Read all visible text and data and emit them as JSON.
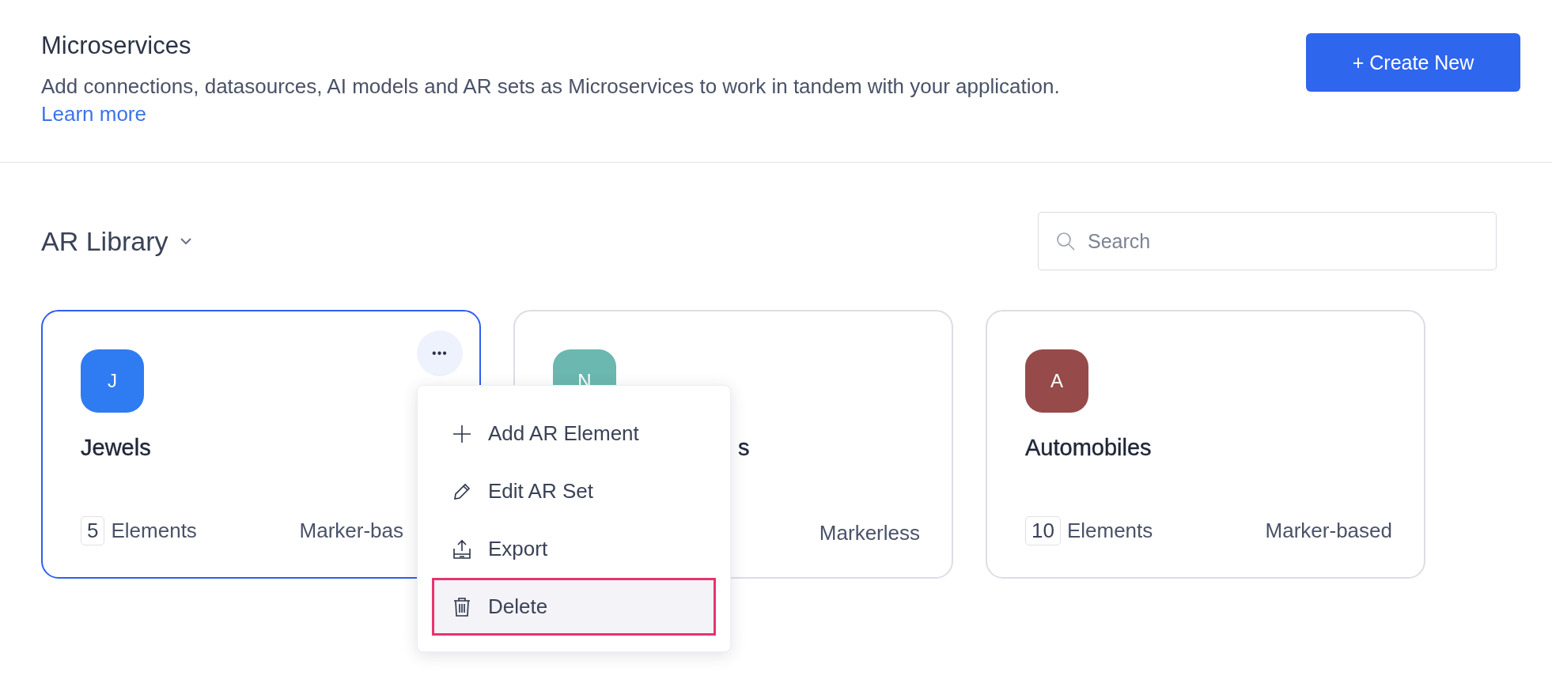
{
  "header": {
    "title": "Microservices",
    "description": "Add connections, datasources, AI models and AR sets as Microservices to work in tandem with your application.",
    "link": "Learn more",
    "create_button": "+ Create New"
  },
  "library": {
    "title": "AR Library",
    "search": {
      "placeholder": "Search"
    }
  },
  "cards": [
    {
      "initial": "J",
      "color": "#2f7bf2",
      "title": "Jewels",
      "count": "5",
      "count_label": "Elements",
      "type": "Marker-bas",
      "selected": true,
      "kind": "full"
    },
    {
      "initial": "N",
      "color": "#6bb8b0",
      "title": "s",
      "type": "Markerless",
      "selected": false,
      "kind": "covered"
    },
    {
      "initial": "A",
      "color": "#964a49",
      "title": "Automobiles",
      "count": "10",
      "count_label": "Elements",
      "type": "Marker-based",
      "selected": false,
      "kind": "full"
    }
  ],
  "menu": {
    "more_button": "•••",
    "items": [
      {
        "kind": "add",
        "label": "Add AR Element",
        "selected": false
      },
      {
        "kind": "edit",
        "label": "Edit AR Set",
        "selected": false
      },
      {
        "kind": "export",
        "label": "Export",
        "selected": false
      },
      {
        "kind": "delete",
        "label": "Delete",
        "selected": true
      }
    ]
  }
}
